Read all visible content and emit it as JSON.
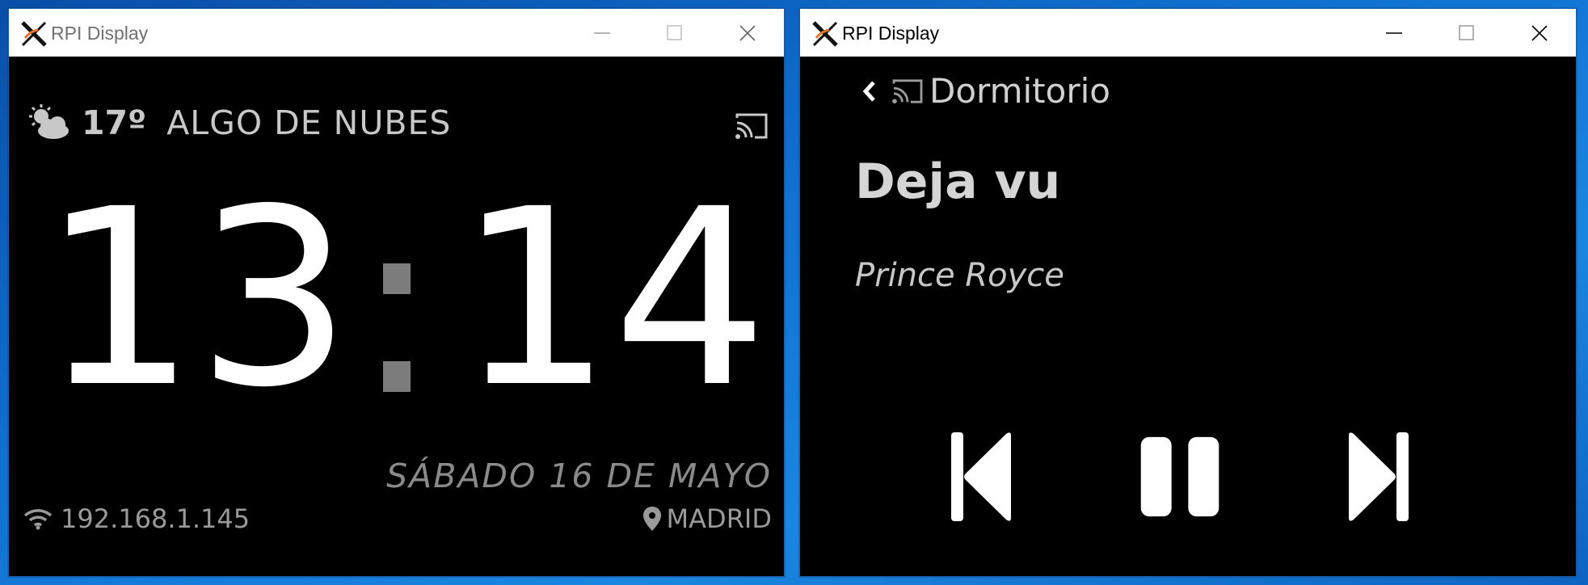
{
  "windows": {
    "left": {
      "title": "RPI Display",
      "weather": {
        "icon": "partly-cloudy-icon",
        "temperature": "17º",
        "condition": "ALGO DE NUBES"
      },
      "clock": {
        "hours": "13",
        "minutes": "14"
      },
      "date": "SÁBADO 16 DE MAYO",
      "ip_address": "192.168.1.145",
      "location": "MADRID"
    },
    "right": {
      "title": "RPI Display",
      "device_name": "Dormitorio",
      "song_title": "Deja vu",
      "artist": "Prince Royce"
    }
  },
  "icons": {
    "weather": "partly-cloudy-icon",
    "cast": "cast-icon",
    "wifi": "wifi-icon",
    "location": "location-pin-icon",
    "back": "chevron-left-icon",
    "previous": "skip-previous-icon",
    "pause": "pause-icon",
    "next": "skip-next-icon",
    "minimize": "minimize-icon",
    "maximize": "maximize-icon",
    "close": "close-icon"
  },
  "colors": {
    "desktop": "#1070d0",
    "window_bg": "#000000",
    "titlebar_bg": "#ffffff",
    "clock_text": "#ffffff",
    "colon": "#7c7c7c",
    "muted_text": "#9a9a9a"
  }
}
